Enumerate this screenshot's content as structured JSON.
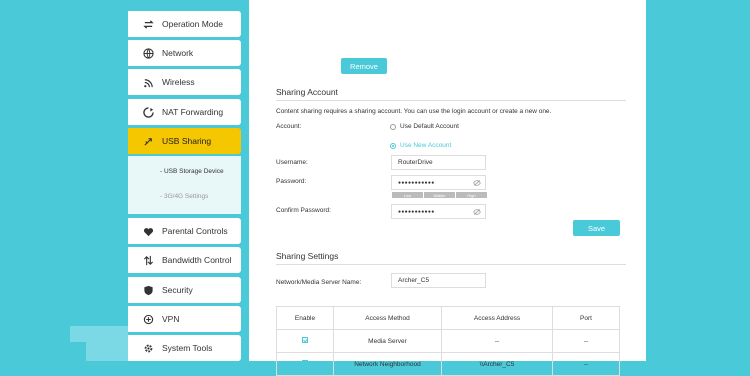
{
  "sidebar": {
    "items": [
      {
        "label": "Operation Mode",
        "icon": "swap-icon"
      },
      {
        "label": "Network",
        "icon": "globe-icon"
      },
      {
        "label": "Wireless",
        "icon": "wifi-icon"
      },
      {
        "label": "NAT Forwarding",
        "icon": "nat-icon"
      },
      {
        "label": "USB Sharing",
        "icon": "usb-icon"
      },
      {
        "label": "Parental Controls",
        "icon": "heart-icon"
      },
      {
        "label": "Bandwidth Control",
        "icon": "arrows-icon"
      },
      {
        "label": "Security",
        "icon": "shield-icon"
      },
      {
        "label": "VPN",
        "icon": "vpn-icon"
      },
      {
        "label": "System Tools",
        "icon": "gear-icon"
      }
    ],
    "submenu": [
      "- USB Storage Device",
      "- 3G/4G Settings"
    ]
  },
  "top": {
    "remove_label": "Remove"
  },
  "sharing_account": {
    "title": "Sharing Account",
    "description": "Content sharing requires a sharing account. You can use the login account or create a new one.",
    "account_label": "Account:",
    "option_default": "Use Default Account",
    "option_new": "Use New Account",
    "username_label": "Username:",
    "username_value": "RouterDrive",
    "password_label": "Password:",
    "password_value": "●●●●●●●●●●●",
    "strength": [
      "Low",
      "Middle",
      "High"
    ],
    "confirm_label": "Confirm Password:",
    "confirm_value": "●●●●●●●●●●●",
    "save_label": "Save"
  },
  "sharing_settings": {
    "title": "Sharing Settings",
    "server_name_label": "Network/Media Server Name:",
    "server_name_value": "Archer_C5",
    "columns": [
      "Enable",
      "Access Method",
      "Access Address",
      "Port"
    ],
    "rows": [
      {
        "method": "Media Server",
        "address": "--",
        "port": "--"
      },
      {
        "method": "Network Neighborhood",
        "address": "\\\\Archer_C5",
        "port": "--"
      }
    ]
  },
  "colors": {
    "accent": "#4ac9d9",
    "active": "#f5c700"
  }
}
